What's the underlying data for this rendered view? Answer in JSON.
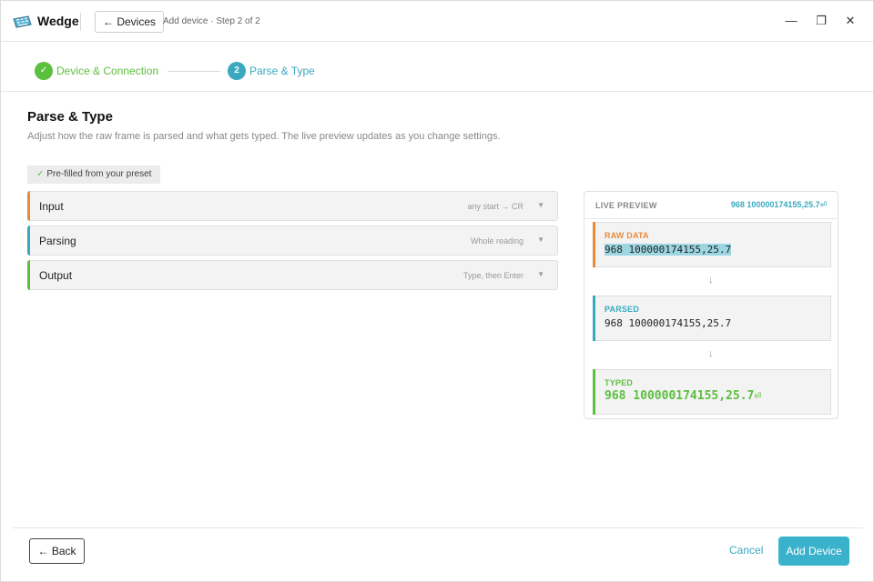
{
  "window": {
    "app_name": "Wedge",
    "app_icon": "keyboard-icon",
    "back_button_label": "← Devices",
    "breadcrumb": "Add device · Step 2 of 2",
    "controls": {
      "minimize": "—",
      "maximize": "❐",
      "close": "✕"
    }
  },
  "stepper": {
    "steps": [
      {
        "index": "✓",
        "label": "Device & Connection",
        "state": "complete",
        "color": "#5cbf3e"
      },
      {
        "index": "2",
        "label": "Parse & Type",
        "state": "active",
        "color": "#3aa9bf"
      }
    ]
  },
  "page": {
    "title": "Parse & Type",
    "subtitle": "Adjust how the raw frame is parsed and what gets typed. The live preview updates as you change settings.",
    "badge_check": "✓",
    "badge_text": "Pre-filled from your preset"
  },
  "sections": [
    {
      "title": "Input",
      "summary": "any start → CR",
      "accent": "#e88a3a",
      "chevron": "▼"
    },
    {
      "title": "Parsing",
      "summary": "Whole reading",
      "accent": "#3aa9bf",
      "chevron": "▼"
    },
    {
      "title": "Output",
      "summary": "Type, then Enter",
      "accent": "#5cbf3e",
      "chevron": "▼"
    }
  ],
  "preview": {
    "header_label": "LIVE PREVIEW",
    "header_value": "968 100000174155,25.7⏎",
    "raw": {
      "label": "RAW DATA",
      "value": "968 100000174155,25.7"
    },
    "parsed": {
      "label": "PARSED",
      "value": "968 100000174155,25.7"
    },
    "typed": {
      "label": "TYPED",
      "value": "968 100000174155,25.7⏎"
    },
    "arrow": "↓"
  },
  "footer": {
    "back_label": "← Back",
    "cancel_label": "Cancel",
    "add_label": "Add Device"
  },
  "colors": {
    "accent_teal": "#3aa9bf",
    "accent_green": "#5cbf3e",
    "accent_orange": "#e88a3a"
  }
}
